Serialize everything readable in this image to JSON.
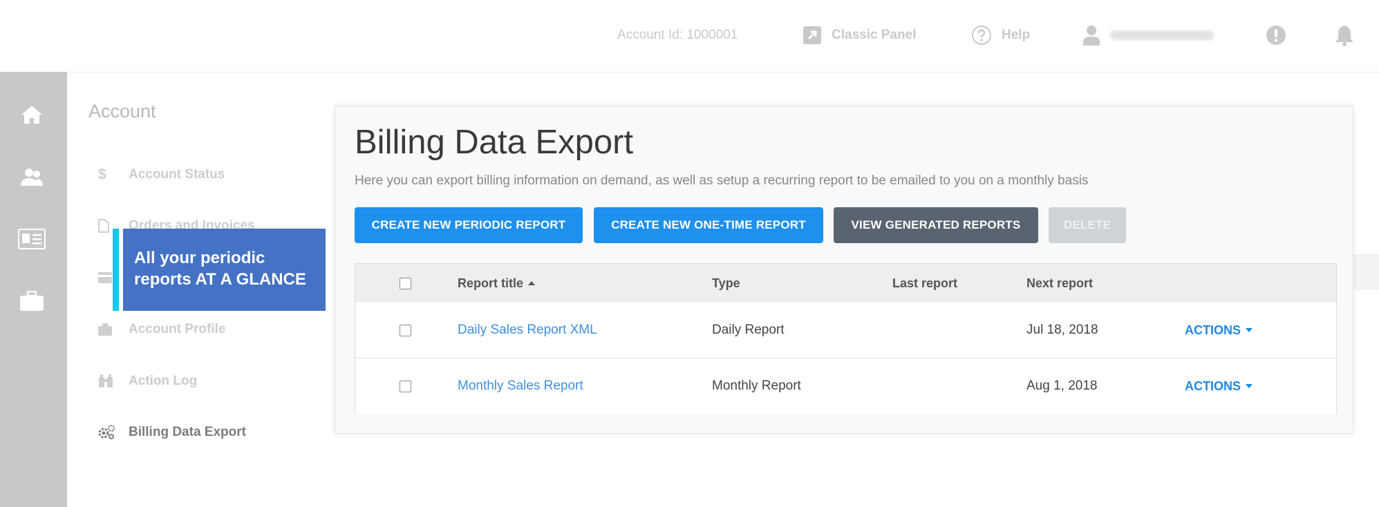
{
  "header": {
    "account_id": "Account Id: 1000001",
    "classic_panel": "Classic Panel",
    "help": "Help"
  },
  "sidebar": {
    "title": "Account",
    "items": [
      {
        "label": "Account Status",
        "icon": "dollar-icon"
      },
      {
        "label": "Orders and Invoices",
        "icon": "document-icon"
      },
      {
        "label": "",
        "icon": "credit-card-icon"
      },
      {
        "label": "Account Profile",
        "icon": "briefcase-icon"
      },
      {
        "label": "Action Log",
        "icon": "binoculars-icon"
      },
      {
        "label": "Billing Data Export",
        "icon": "gears-icon"
      }
    ]
  },
  "callout": {
    "line1": "All your periodic",
    "line2": "reports AT A GLANCE"
  },
  "main": {
    "title": "Billing Data Export",
    "description": "Here you can export billing information on demand, as well as setup a recurring report to be emailed to you on a monthly basis",
    "buttons": {
      "create_periodic": "CREATE NEW PERIODIC REPORT",
      "create_one_time": "CREATE NEW ONE-TIME REPORT",
      "view_generated": "VIEW GENERATED REPORTS",
      "delete": "DELETE"
    },
    "table": {
      "columns": [
        "Report title",
        "Type",
        "Last report",
        "Next report"
      ],
      "rows": [
        {
          "title": "Daily Sales Report XML",
          "type": "Daily Report",
          "last": "",
          "next": "Jul 18, 2018",
          "action": "ACTIONS"
        },
        {
          "title": "Monthly Sales Report",
          "type": "Monthly Report",
          "last": "",
          "next": "Aug 1, 2018",
          "action": "ACTIONS"
        }
      ]
    }
  },
  "colors": {
    "primary": "#1e90ee",
    "dark_button": "#5a6470",
    "callout_bg": "#4472c4",
    "callout_accent": "#16c8f0",
    "link": "#3e8fe0"
  }
}
